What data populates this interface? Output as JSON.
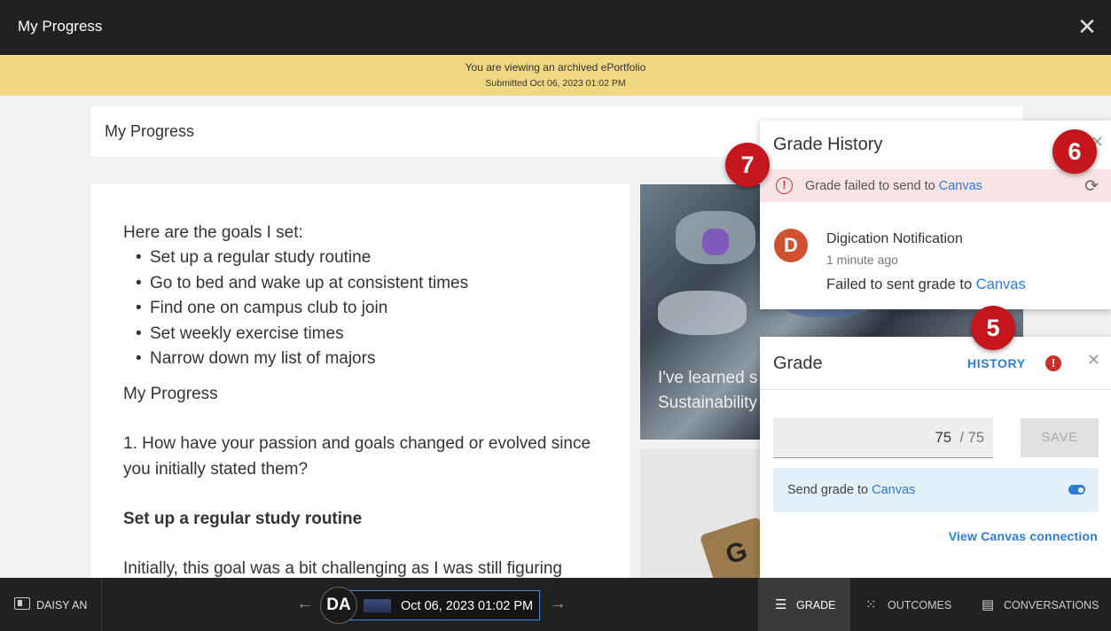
{
  "window": {
    "title": "My Progress"
  },
  "banner": {
    "line1": "You are viewing an archived ePortfolio",
    "line2": "Submitted Oct 06, 2023 01:02 PM"
  },
  "page": {
    "heading": "My Progress",
    "intro": "Here are the goals I set:",
    "goals": [
      "Set up a regular study routine",
      "Go to bed and wake up at consistent times",
      "Find one on campus club to join",
      "Set weekly exercise times",
      "Narrow down my list of majors"
    ],
    "subheading": "My Progress",
    "question": "1. How have your passion and goals changed or evolved since you initially stated them?",
    "bold_heading": "Set up a regular study routine",
    "paragraph_start": "Initially, this goal was a bit challenging as I was still figuring",
    "image_caption_line1": "I've learned s",
    "image_caption_line2": "Sustainability",
    "tile_letter": "G"
  },
  "grade_history": {
    "title": "Grade History",
    "error_prefix": "Grade failed to send to ",
    "error_link": "Canvas",
    "notification": {
      "avatar_letter": "D",
      "sender": "Digication Notification",
      "time": "1 minute ago",
      "message_prefix": "Failed to sent grade to ",
      "message_link": "Canvas"
    }
  },
  "grade_panel": {
    "title": "Grade",
    "history_label": "HISTORY",
    "alert_symbol": "!",
    "score_value": "75",
    "score_max": "/ 75",
    "save_label": "SAVE",
    "send_prefix": "Send grade to ",
    "send_link": "Canvas",
    "send_enabled": true,
    "connection_link": "View Canvas connection"
  },
  "badges": [
    "7",
    "6",
    "5"
  ],
  "bottom_bar": {
    "user_name": "DAISY AN",
    "user_initials": "DA",
    "submission_date": "Oct 06, 2023 01:02 PM",
    "tabs": [
      {
        "label": "GRADE",
        "icon": "grade-icon",
        "active": true
      },
      {
        "label": "OUTCOMES",
        "icon": "outcomes-icon",
        "active": false
      },
      {
        "label": "CONVERSATIONS",
        "icon": "conversations-icon",
        "active": false
      }
    ]
  },
  "colors": {
    "accent": "#2e7bd6",
    "error": "#c9302c",
    "badge": "#c4161c",
    "banner": "#f1d783",
    "topbar": "#212121"
  }
}
